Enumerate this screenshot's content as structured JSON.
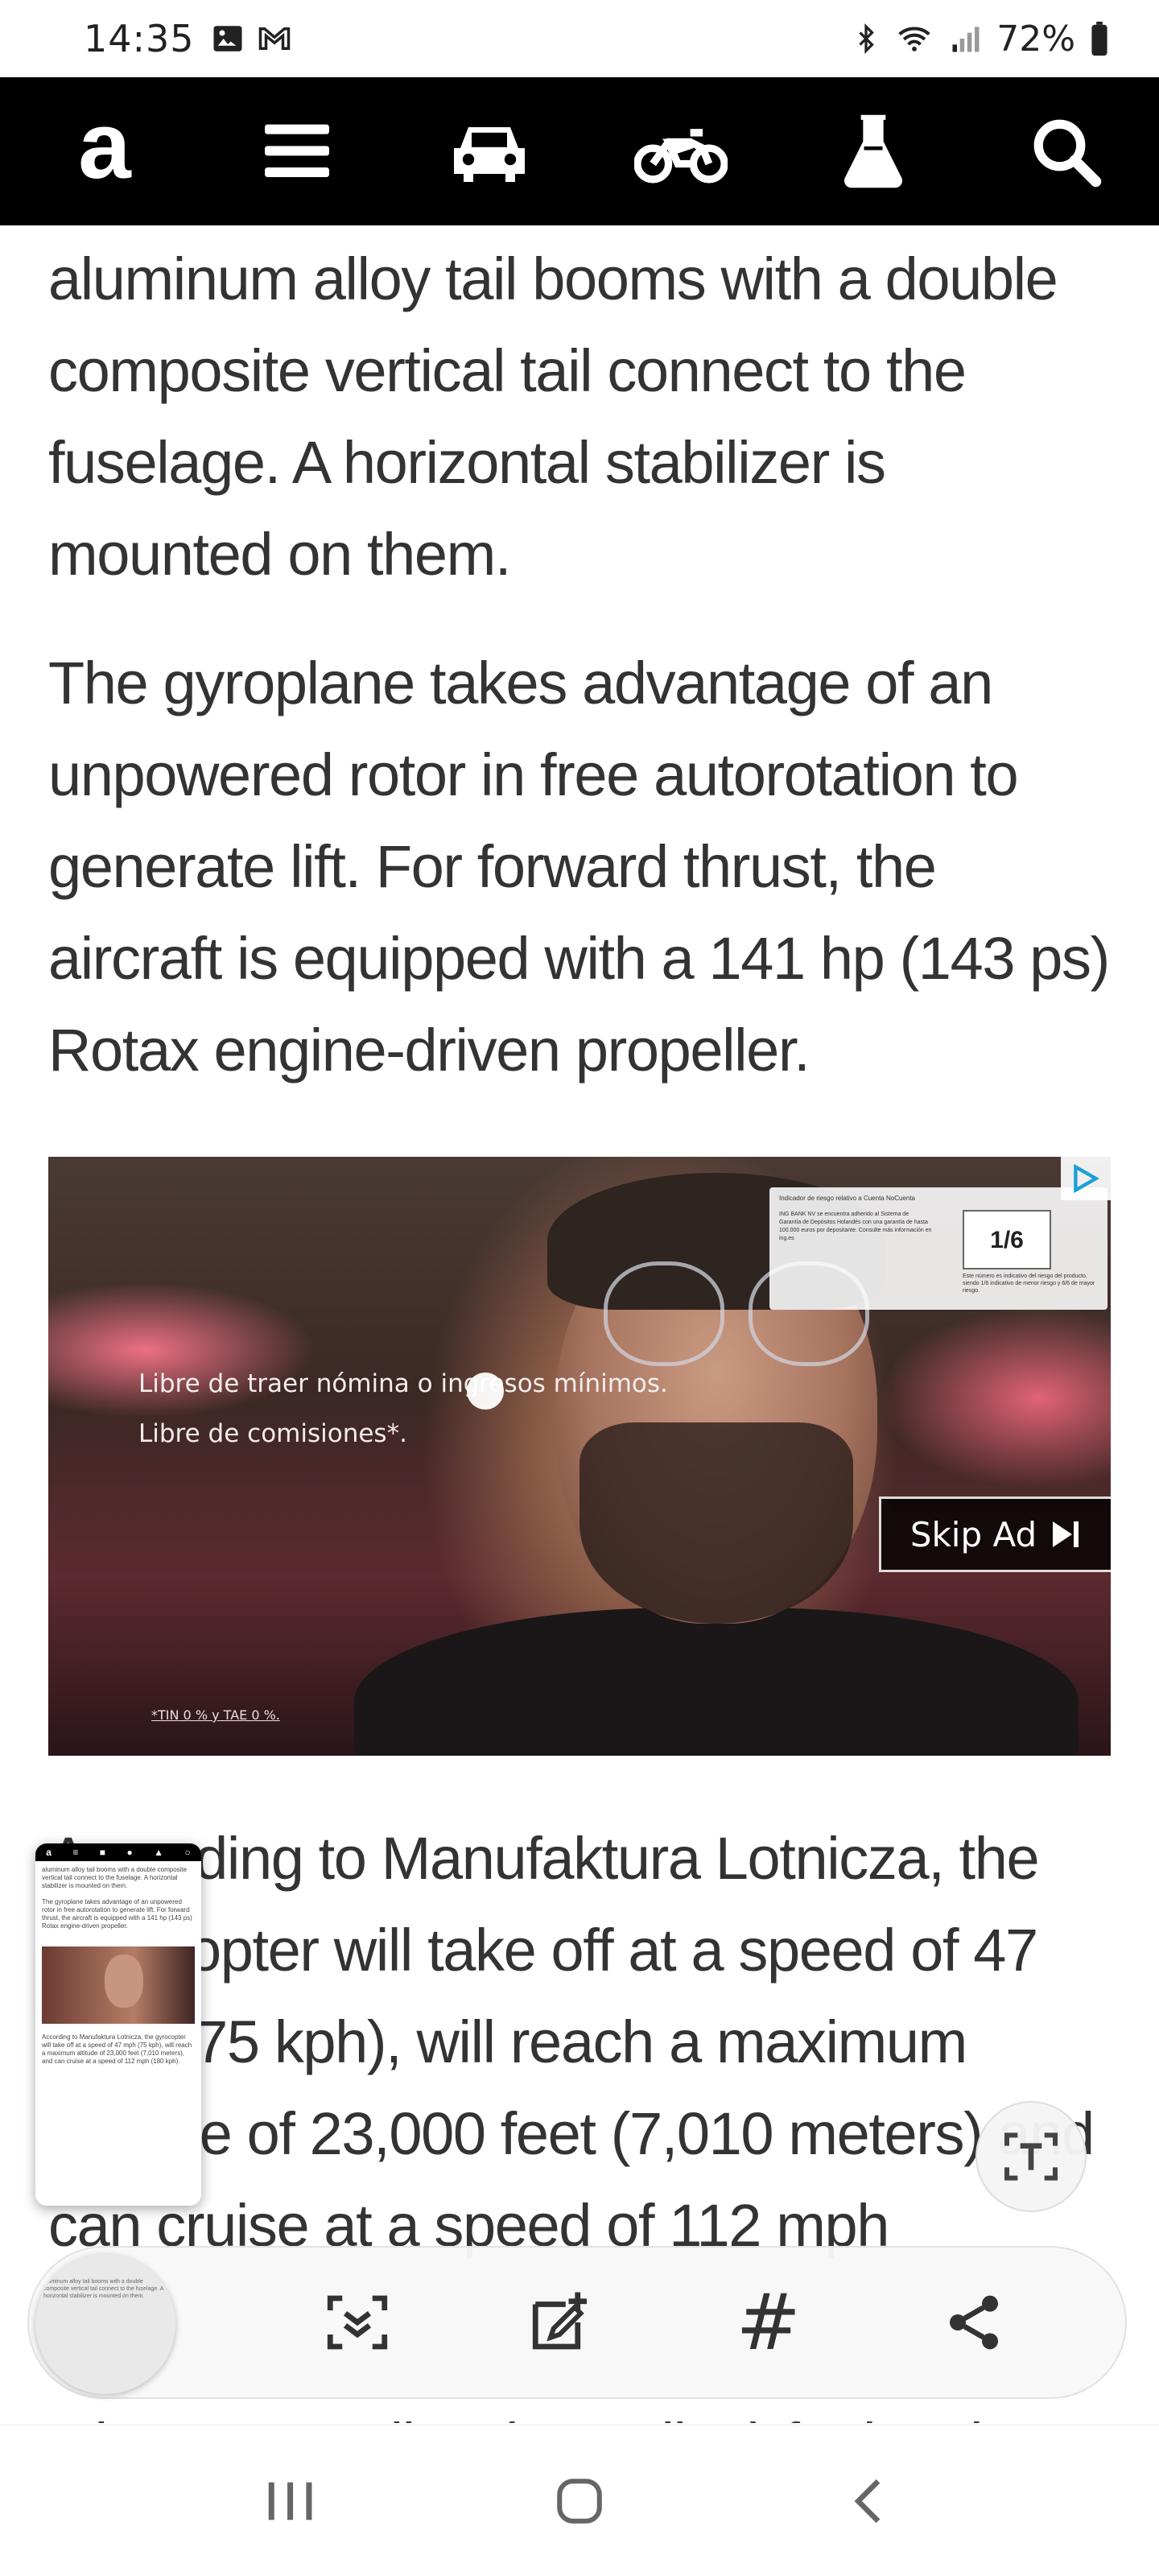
{
  "status_bar": {
    "time": "14:35",
    "battery": "72%",
    "icons_left": [
      "gallery-icon",
      "gmail-icon"
    ],
    "icons_right": [
      "bluetooth-icon",
      "wifi-icon",
      "signal-icon",
      "battery-icon"
    ]
  },
  "nav": {
    "logo": "a",
    "items": [
      "menu-icon",
      "car-icon",
      "motorcycle-icon",
      "flask-icon",
      "search-icon"
    ]
  },
  "article": {
    "p1": "aluminum alloy tail booms with a double composite vertical tail connect to the fuselage. A horizontal stabilizer is mounted on them.",
    "p2": "The gyroplane takes advantage of an unpowered rotor in free autorotation to generate lift. For forward thrust, the aircraft is equipped with a 141 hp (143 ps) Rotax engine-driven propeller.",
    "p3": "According to Manufaktura Lotnicza, the gyrocopter will take off at a speed of 47 mph (75 kph), will reach a maximum altitude of 23,000 feet (7,010 meters) and can cruise at a speed of 112 mph",
    "p4": "It has two 80-liter (18-gallon) fuel tanks"
  },
  "ad": {
    "line1": "Libre de traer nómina o ingresos mínimos.",
    "line2": "Libre de comisiones*.",
    "fine_print": "*TIN 0 % y TAE 0 %.",
    "risk_title": "Indicador de riesgo relativo a Cuenta NoCuenta",
    "risk_body": "ING BANK NV se encuentra adherido al Sistema de Garantía de Depósitos Holandés con una garantía de hasta 100.000 euros por depositante. Consulte más información en ing.es",
    "risk_number": "1/6",
    "risk_note": "Este número es indicativo del riesgo del producto, siendo 1/6 indicativo de menor riesgo y 6/6 de mayor riesgo.",
    "skip_label": "Skip Ad"
  },
  "thumb": {
    "p1": "aluminum alloy tail booms with a double composite vertical tail connect to the fuselage. A horizontal stabilizer is mounted on them.",
    "p2": "The gyroplane takes advantage of an unpowered rotor in free autorotation to generate lift. For forward thrust, the aircraft is equipped with a 141 hp (143 ps) Rotax engine-driven propeller.",
    "p3": "According to Manufaktura Lotnicza, the gyrocopter will take off at a speed of 47 mph (75 kph), will reach a maximum altitude of 23,000 feet (7,010 meters), and can cruise at a speed of 112 mph (180 kph)."
  },
  "toolbar": {
    "items": [
      "scroll-capture-icon",
      "edit-icon",
      "hashtag-icon",
      "share-icon"
    ],
    "hashtag": "#"
  },
  "system_nav": [
    "recents-icon",
    "home-icon",
    "back-icon"
  ]
}
